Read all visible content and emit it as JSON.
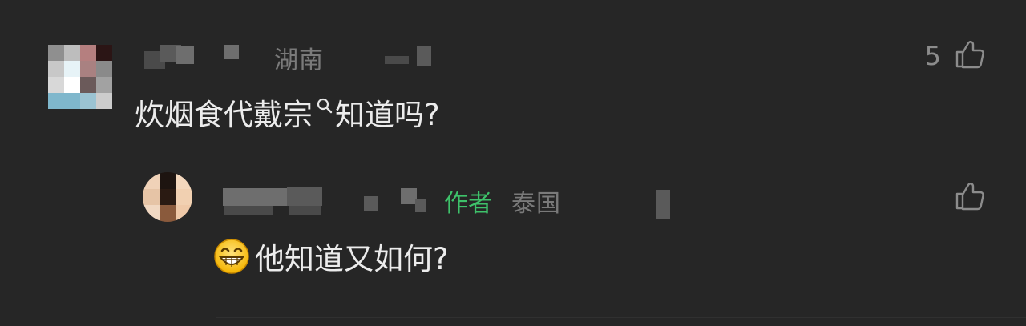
{
  "comments": [
    {
      "location": "湖南",
      "text_before": "炊烟食代戴宗",
      "search_icon": "search-icon",
      "text_after": "知道吗?",
      "like_count": "5",
      "like_icon": "thumbs-up-icon",
      "avatar_colors": [
        "#8f8f8f",
        "#bdbdbd",
        "#b57f7f",
        "#2b1515",
        "#c8c8c8",
        "#e7f3f7",
        "#a98181",
        "#8a8a8a",
        "#d8d8d8",
        "#ffffff",
        "#6b5a5a",
        "#a2a2a2",
        "#7fb7cc",
        "#7fb7cc",
        "#9bc3d2",
        "#cccccc"
      ]
    },
    {
      "author_tag": "作者",
      "location": "泰国",
      "emoji_icon": "grinning-face-emoji",
      "text": "他知道又如何?",
      "like_icon": "thumbs-up-icon",
      "avatar_colors": [
        "#f0d2b8",
        "#1d1410",
        "#f3d7bd",
        "#e6c4a6",
        "#2a1a12",
        "#f1d0b1",
        "#f1d8c2",
        "#8a5a3c",
        "#efc9a8"
      ]
    }
  ]
}
